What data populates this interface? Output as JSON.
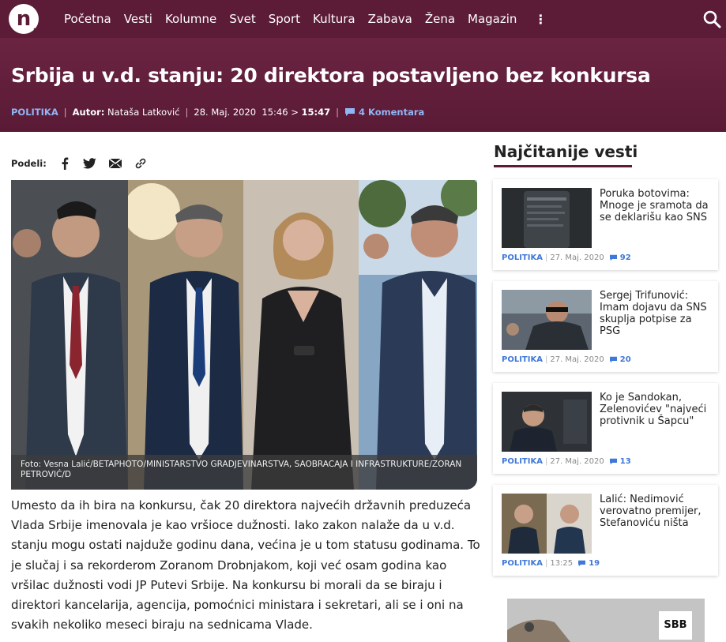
{
  "header": {
    "logo_letter": "n",
    "logo_sub": "s",
    "nav": [
      "Početna",
      "Vesti",
      "Kolumne",
      "Svet",
      "Sport",
      "Kultura",
      "Zabava",
      "Žena",
      "Magazin"
    ],
    "more_glyph": "⋮"
  },
  "article": {
    "title": "Srbija u v.d. stanju: 20 direktora postavljeno bez konkursa",
    "category": "POLITIKA",
    "author_label": "Autor:",
    "author": "Nataša Latković",
    "date": "28. Maj. 2020",
    "time_created": "15:46 >",
    "time_updated": "15:47",
    "comments": "4 Komentara",
    "share_label": "Podeli:",
    "photo_caption": "Foto: Vesna Lalić/BETAPHOTO/MINISTARSTVO GRADJEVINARSTVA, SAOBRACAJA I INFRASTRUKTURE/ZORAN PETROVIĆ/D",
    "body": "Umesto da ih bira na konkursu, čak 20 direktora najvećih državnih preduzeća Vlada Srbije imenovala je kao vršioce dužnosti. Iako zakon nalaže da u v.d. stanju mogu ostati najduže godinu dana, većina je u tom statusu godinama. To je slučaj i sa rekorderom Zoranom Drobnjakom, koji već osam godina kao vršilac dužnosti vodi JP Putevi Srbije. Na konkursu bi morali da se biraju i direktori kancelarija, agencija, pomoćnici ministara i sekretari, ali se i oni na svakih nekoliko meseci biraju na sednicama Vlade."
  },
  "sidebar": {
    "title": "Najčitanije vesti",
    "items": [
      {
        "title": "Poruka botovima: Mnoge je sramota da se deklarišu kao SNS",
        "category": "POLITIKA",
        "date": "27. Maj. 2020",
        "comments": "92"
      },
      {
        "title": "Sergej Trifunović: Imam dojavu da SNS skuplja potpise za PSG",
        "category": "POLITIKA",
        "date": "27. Maj. 2020",
        "comments": "20"
      },
      {
        "title": "Ko je Sandokan, Zelenovićev \"najveći protivnik u Šapcu\"",
        "category": "POLITIKA",
        "date": "27. Maj. 2020",
        "comments": "13"
      },
      {
        "title": "Lalić: Nedimović verovatno premijer, Stefanoviću ništa",
        "category": "POLITIKA",
        "date": "13:25",
        "comments": "19"
      }
    ]
  },
  "ad": {
    "logo": "SBB"
  },
  "colors": {
    "brand": "#5c1b37",
    "accent": "#8fb6f5",
    "link": "#3f78d8"
  },
  "icons": [
    "search-icon",
    "facebook-icon",
    "twitter-icon",
    "email-icon",
    "link-icon",
    "comment-icon"
  ]
}
